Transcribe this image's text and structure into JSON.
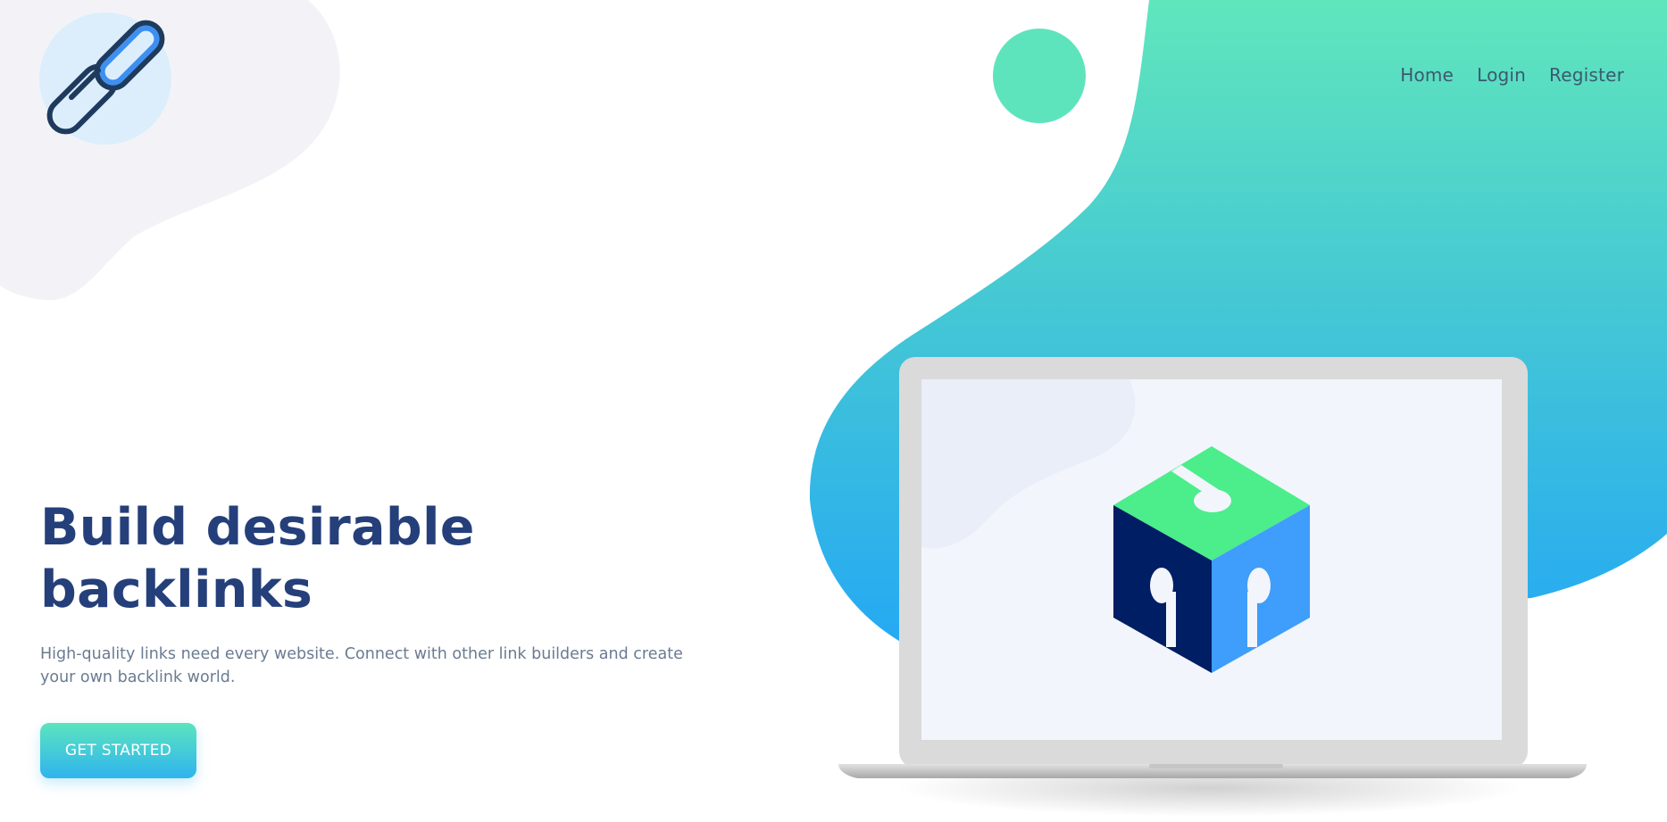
{
  "nav": {
    "items": [
      {
        "label": "Home"
      },
      {
        "label": "Login"
      },
      {
        "label": "Register"
      }
    ]
  },
  "hero": {
    "title_line1": "Build desirable",
    "title_line2": "backlinks",
    "description_line1": "High-quality links need every website. Connect with other link builders and create",
    "description_line2": "your own backlink world.",
    "cta_label": "GET STARTED"
  },
  "icons": {
    "logo": "chain-link-icon",
    "laptop": "laptop-illustration",
    "cube": "cube-logo-icon"
  },
  "colors": {
    "title": "#243f7a",
    "nav_text": "#3a5a6e",
    "body_text": "#6a7b92",
    "gradient_top": "#5ce4be",
    "gradient_bottom": "#2fb4ef",
    "cube_green": "#4ced8b",
    "cube_navy": "#001e64",
    "cube_blue": "#3f9dfb",
    "logo_dark": "#1e3b5e",
    "logo_blue": "#3d8ff2"
  }
}
